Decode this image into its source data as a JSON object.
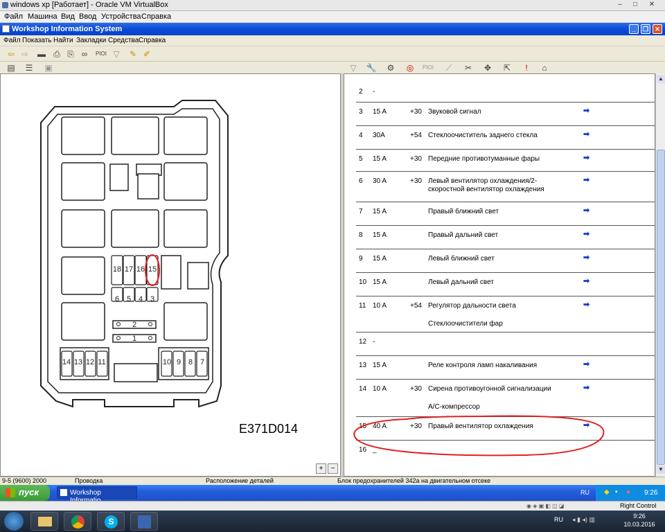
{
  "host": {
    "title": "windows xp [Работает] - Oracle VM VirtualBox",
    "menu": [
      "Файл",
      "Машина",
      "Вид",
      "Ввод",
      "Устройства",
      "Справка"
    ]
  },
  "app": {
    "title": "Workshop Information System",
    "menu": [
      "Файл",
      "Показать",
      "Найти",
      "Закладки",
      "Средства",
      "Справка"
    ]
  },
  "diagram": {
    "caption": "E371D014",
    "fuse_labels_top": [
      "18",
      "17",
      "16",
      "15"
    ],
    "fuse_labels_mid": [
      "6",
      "5",
      "4",
      "3"
    ],
    "fuse_bar_2": "2",
    "fuse_bar_1": "1",
    "fuse_labels_bottom_left": [
      "14",
      "13",
      "12",
      "11"
    ],
    "fuse_labels_bottom_right": [
      "10",
      "9",
      "8",
      "7"
    ]
  },
  "fuses": [
    {
      "n": "2",
      "amp": "-",
      "term": "",
      "desc": "",
      "desc2": "",
      "arrow": false
    },
    {
      "n": "3",
      "amp": "15 A",
      "term": "+30",
      "desc": "Звуковой сигнал",
      "desc2": "",
      "arrow": true
    },
    {
      "n": "4",
      "amp": "30A",
      "term": "+54",
      "desc": "Стеклоочиститель заднего стекла",
      "desc2": "",
      "arrow": true
    },
    {
      "n": "5",
      "amp": "15 A",
      "term": "+30",
      "desc": "Передние противотуманные фары",
      "desc2": "",
      "arrow": true
    },
    {
      "n": "6",
      "amp": "30 A",
      "term": "+30",
      "desc": "Левый вентилятор охлаждения/2-",
      "desc2": "скоростной вентилятор охлаждения",
      "arrow": true
    },
    {
      "n": "7",
      "amp": "15 A",
      "term": "",
      "desc": "Правый ближний свет",
      "desc2": "",
      "arrow": true
    },
    {
      "n": "8",
      "amp": "15 A",
      "term": "",
      "desc": "Правый дальний свет",
      "desc2": "",
      "arrow": true
    },
    {
      "n": "9",
      "amp": "15 A",
      "term": "",
      "desc": "Левый ближний свет",
      "desc2": "",
      "arrow": true
    },
    {
      "n": "10",
      "amp": "15 A",
      "term": "",
      "desc": "Левый дальний свет",
      "desc2": "",
      "arrow": true
    },
    {
      "n": "11",
      "amp": "10 A",
      "term": "+54",
      "desc": "Регулятор дальности света",
      "desc2": "Стеклоочистители фар",
      "arrow": true
    },
    {
      "n": "12",
      "amp": "-",
      "term": "",
      "desc": "",
      "desc2": "",
      "arrow": false
    },
    {
      "n": "13",
      "amp": "15 A",
      "term": "",
      "desc": "Реле контроля ламп накаливания",
      "desc2": "",
      "arrow": true
    },
    {
      "n": "14",
      "amp": "10 A",
      "term": "+30",
      "desc": "Сирена противоугонной сигнализации",
      "desc2": "A/C-компрессор",
      "arrow": true
    },
    {
      "n": "15",
      "amp": "40 A",
      "term": "+30",
      "desc": "Правый вентилятор охлаждения",
      "desc2": "",
      "arrow": true
    },
    {
      "n": "16",
      "amp": "_",
      "term": "",
      "desc": "",
      "desc2": "",
      "arrow": false
    }
  ],
  "status": {
    "model": "9-5 (9600) 2000",
    "section": "Проводка",
    "view": "Расположение деталей",
    "item": "Блок предохранителей 342a на двигательном отсеке"
  },
  "xp_taskbar": {
    "start": "пуск",
    "task": "Workshop Informatio...",
    "lang": "RU",
    "time": "9:26"
  },
  "host_status": {
    "right_control": "Right Control"
  },
  "win7": {
    "lang": "RU",
    "time": "9:26",
    "date": "10.03.2016"
  },
  "colors": {
    "xp_title": "#0a4ad6",
    "highlight_circle": "#e02020",
    "link_arrow": "#1a3fcf"
  }
}
